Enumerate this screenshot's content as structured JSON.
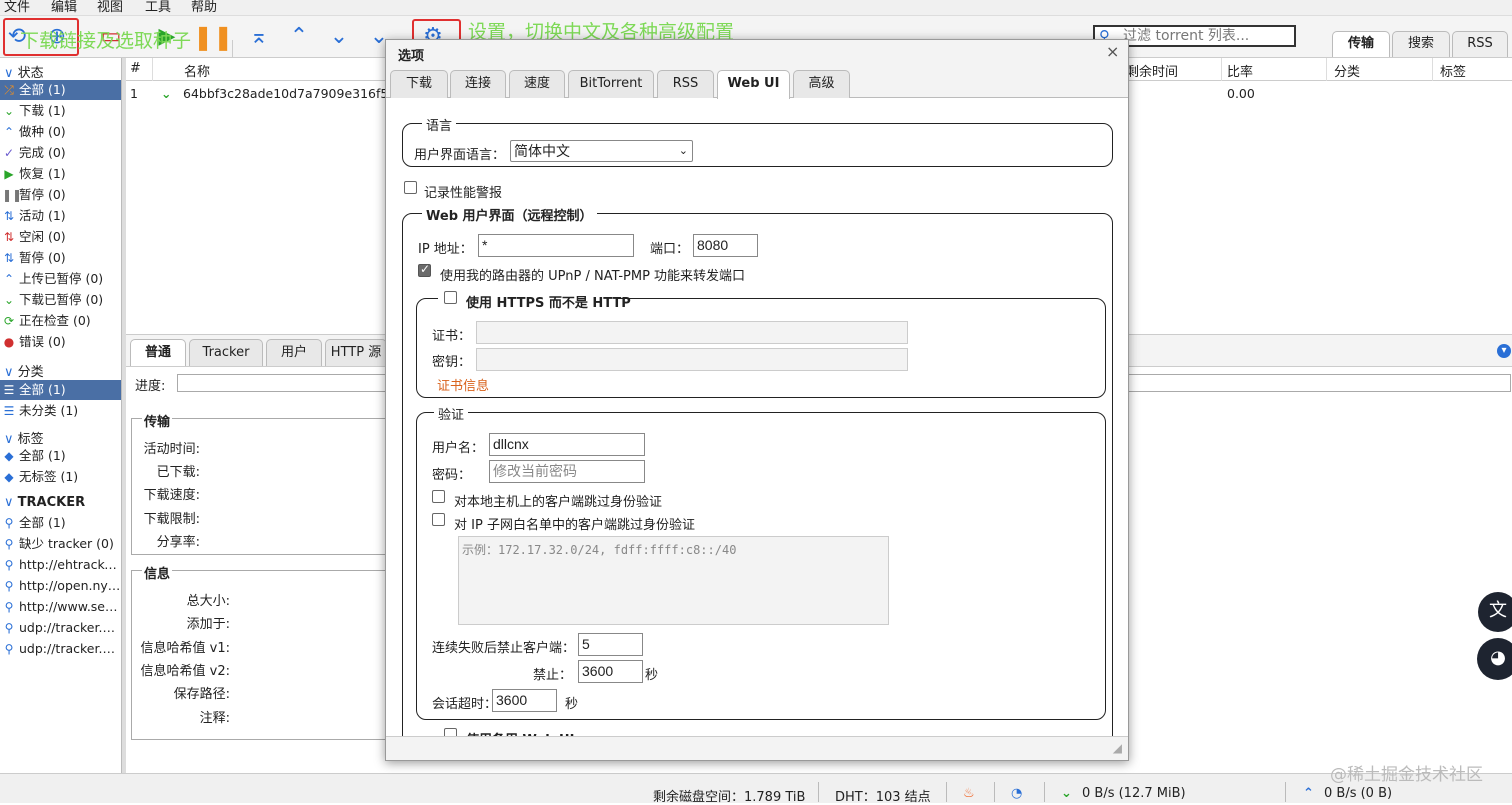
{
  "menu": [
    "文件",
    "编辑",
    "视图",
    "工具",
    "帮助"
  ],
  "annotations": {
    "add_torrent": "下载链接及选取种子",
    "settings": "设置，切换中文及各种高级配置"
  },
  "filter_placeholder": "过滤 torrent 列表...",
  "right_tabs": [
    "传输",
    "搜索",
    "RSS"
  ],
  "sidebar": {
    "status_header": "状态",
    "status_items": [
      "全部 (1)",
      "下载 (1)",
      "做种 (0)",
      "完成 (0)",
      "恢复 (1)",
      "暂停 (0)",
      "活动 (1)",
      "空闲 (0)",
      "暂停 (0)",
      "上传已暂停 (0)",
      "下载已暂停 (0)",
      "正在检查 (0)",
      "错误 (0)"
    ],
    "category_header": "分类",
    "category_items": [
      "全部 (1)",
      "未分类 (1)"
    ],
    "tag_header": "标签",
    "tag_items": [
      "全部 (1)",
      "无标签 (1)"
    ],
    "tracker_header": "TRACKER",
    "tracker_items": [
      "全部 (1)",
      "缺少 tracker (0)",
      "http://ehtracker....",
      "http://open.nya...",
      "http://www.seoi...",
      "udp://tracker.op...",
      "udp://tracker.pu..."
    ]
  },
  "table": {
    "headers": [
      "#",
      "名称",
      "剩余时间",
      "比率",
      "分类",
      "标签"
    ],
    "row": {
      "num": "1",
      "name": "64bbf3c28ade10d7a7909e316f59...",
      "ratio": "0.00"
    }
  },
  "properties": {
    "tabs": [
      "普通",
      "Tracker",
      "用户",
      "HTTP 源"
    ],
    "progress_label": "进度:",
    "transfer_legend": "传输",
    "transfer_labels": [
      "活动时间:",
      "已下载:",
      "下载速度:",
      "下载限制:",
      "分享率:"
    ],
    "info_legend": "信息",
    "info_labels": [
      "总大小:",
      "添加于:",
      "信息哈希值 v1:",
      "信息哈希值 v2:",
      "保存路径:",
      "注释:"
    ]
  },
  "status_bar": {
    "disk": "剩余磁盘空间：1.789 TiB",
    "dht": "DHT：103 结点",
    "down": "0 B/s (12.7 MiB)",
    "up": "0 B/s (0 B)"
  },
  "watermark": "@稀土掘金技术社区",
  "dialog": {
    "title": "选项",
    "close": "×",
    "tabs": [
      "下载",
      "连接",
      "速度",
      "BitTorrent",
      "RSS",
      "Web UI",
      "高级"
    ],
    "active_tab": "Web UI",
    "language_legend": "语言",
    "ui_language_label": "用户界面语言：",
    "ui_language_value": "简体中文",
    "log_perf_label": "记录性能警报",
    "webui_legend": "Web 用户界面（远程控制）",
    "ip_label": "IP 地址：",
    "ip_value": "*",
    "port_label": "端口：",
    "port_value": "8080",
    "upnp_label": "使用我的路由器的 UPnP / NAT-PMP 功能来转发端口",
    "https_label": "使用 HTTPS 而不是 HTTP",
    "cert_label": "证书：",
    "key_label": "密钥：",
    "cert_info_link": "证书信息",
    "auth_legend": "验证",
    "username_label": "用户名：",
    "username_value": "dllcnx",
    "password_label": "密码：",
    "password_placeholder": "修改当前密码",
    "bypass_local_label": "对本地主机上的客户端跳过身份验证",
    "bypass_whitelist_label": "对 IP 子网白名单中的客户端跳过身份验证",
    "whitelist_placeholder": "示例：172.17.32.0/24, fdff:ffff:c8::/40",
    "ban_after_label": "连续失败后禁止客户端：",
    "ban_after_value": "5",
    "ban_for_label": "禁止：",
    "ban_for_value": "3600",
    "seconds_unit": "秒",
    "session_timeout_label": "会话超时：",
    "session_timeout_value": "3600",
    "alt_webui_label": "使用备用 Web UI"
  },
  "colors": {
    "selection": "#4a6fa5",
    "annotation": "#7ed957",
    "highlight_box": "#e03030",
    "link": "#d9621b"
  }
}
